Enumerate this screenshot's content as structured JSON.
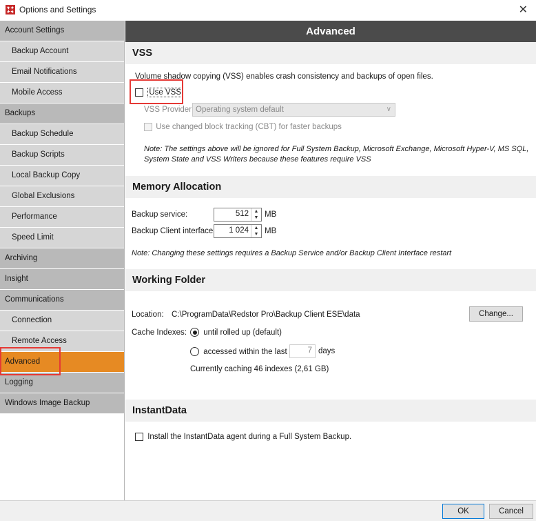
{
  "window": {
    "title": "Options and Settings",
    "close_glyph": "✕",
    "icon": "redstor-logo-icon"
  },
  "sidebar": {
    "items": [
      {
        "label": "Account Settings",
        "kind": "category"
      },
      {
        "label": "Backup Account",
        "kind": "sub"
      },
      {
        "label": "Email Notifications",
        "kind": "sub"
      },
      {
        "label": "Mobile Access",
        "kind": "sub"
      },
      {
        "label": "Backups",
        "kind": "category"
      },
      {
        "label": "Backup Schedule",
        "kind": "sub"
      },
      {
        "label": "Backup Scripts",
        "kind": "sub"
      },
      {
        "label": "Local Backup Copy",
        "kind": "sub"
      },
      {
        "label": "Global Exclusions",
        "kind": "sub"
      },
      {
        "label": "Performance",
        "kind": "sub"
      },
      {
        "label": "Speed Limit",
        "kind": "sub"
      },
      {
        "label": "Archiving",
        "kind": "category"
      },
      {
        "label": "Insight",
        "kind": "category"
      },
      {
        "label": "Communications",
        "kind": "category"
      },
      {
        "label": "Connection",
        "kind": "sub"
      },
      {
        "label": "Remote Access",
        "kind": "sub"
      },
      {
        "label": "Advanced",
        "kind": "active"
      },
      {
        "label": "Logging",
        "kind": "category"
      },
      {
        "label": "Windows Image Backup",
        "kind": "category"
      }
    ]
  },
  "header": {
    "title": "Advanced"
  },
  "vss": {
    "heading": "VSS",
    "description": "Volume shadow copying (VSS) enables crash consistency and backups of open files.",
    "use_vss_label": "Use VSS",
    "use_vss_checked": false,
    "provider_label": "VSS Provider:",
    "provider_value": "Operating system default",
    "cbt_label": "Use changed block tracking (CBT) for faster backups",
    "note_line1": "Note: The settings above will be ignored for Full System Backup, Microsoft Exchange, Microsoft Hyper-V, MS SQL,",
    "note_line2": "System State and VSS Writers because these features require VSS"
  },
  "memory": {
    "heading": "Memory Allocation",
    "service_label": "Backup service:",
    "service_value": "512",
    "client_label": "Backup Client interface:",
    "client_value": "1 024",
    "unit": "MB",
    "note": "Note: Changing these settings requires a Backup Service and/or Backup Client Interface restart"
  },
  "working_folder": {
    "heading": "Working Folder",
    "location_label": "Location:",
    "location_value": "C:\\ProgramData\\Redstor Pro\\Backup Client ESE\\data",
    "change_button": "Change...",
    "cache_label": "Cache Indexes:",
    "option_rolled": "until rolled up (default)",
    "option_accessed": "accessed within the last",
    "days_value": "7",
    "days_unit": "days",
    "caching_status": "Currently caching 46 indexes (2,61 GB)",
    "selected_option": "until rolled up (default)"
  },
  "instantdata": {
    "heading": "InstantData",
    "install_label": "Install the InstantData agent during a Full System Backup.",
    "install_checked": false
  },
  "footer": {
    "ok": "OK",
    "cancel": "Cancel"
  },
  "colors": {
    "accent": "#e68a23",
    "header_bg": "#4b4b4b",
    "highlight": "#e53935"
  }
}
